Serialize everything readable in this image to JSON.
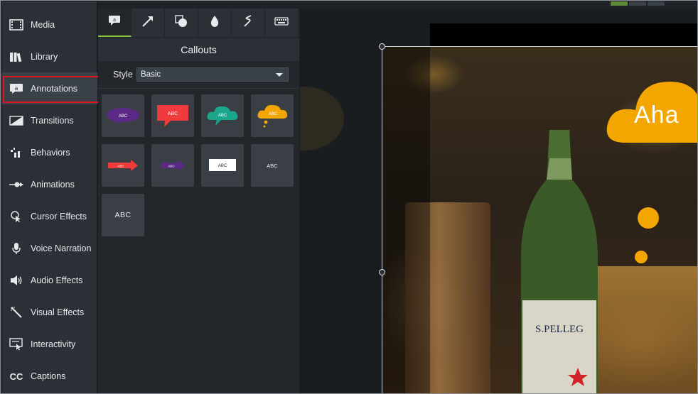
{
  "sidebar": {
    "items": [
      {
        "label": "Media",
        "icon": "film-icon"
      },
      {
        "label": "Library",
        "icon": "library-icon"
      },
      {
        "label": "Annotations",
        "icon": "annotation-icon"
      },
      {
        "label": "Transitions",
        "icon": "transition-icon"
      },
      {
        "label": "Behaviors",
        "icon": "behaviors-icon"
      },
      {
        "label": "Animations",
        "icon": "animation-icon"
      },
      {
        "label": "Cursor Effects",
        "icon": "cursor-icon"
      },
      {
        "label": "Voice Narration",
        "icon": "microphone-icon"
      },
      {
        "label": "Audio Effects",
        "icon": "speaker-icon"
      },
      {
        "label": "Visual Effects",
        "icon": "magic-wand-icon"
      },
      {
        "label": "Interactivity",
        "icon": "interactivity-icon"
      },
      {
        "label": "Captions",
        "icon": "cc-icon"
      }
    ],
    "active_index": 2
  },
  "panel": {
    "tabs": [
      "callout-tab-icon",
      "arrow-icon",
      "shape-icon",
      "blur-drop-icon",
      "sketch-motion-icon",
      "keyboard-icon"
    ],
    "title": "Callouts",
    "style_label": "Style",
    "style_value": "Basic",
    "tiles": [
      {
        "label": "ABC",
        "kind": "speech-bubble",
        "color": "#5b2a86"
      },
      {
        "label": "ABC",
        "kind": "box-callout",
        "color": "#ef3b3b"
      },
      {
        "label": "ABC",
        "kind": "cloud",
        "color": "#1aa88c"
      },
      {
        "label": "ABC",
        "kind": "thought-cloud",
        "color": "#f4a600"
      },
      {
        "label": "ABC",
        "kind": "arrow",
        "color": "#ef3b3b"
      },
      {
        "label": "ABC",
        "kind": "arrow",
        "color": "#5b2a86"
      },
      {
        "label": "ABC",
        "kind": "rectangle",
        "color": "#ffffff"
      },
      {
        "label": "ABC",
        "kind": "text",
        "color": "#e7e9ec"
      },
      {
        "label": "ABC",
        "kind": "text-large",
        "color": "#e7e9ec"
      }
    ]
  },
  "canvas": {
    "callout_text": "Aha",
    "callout_color": "#f4a600",
    "bottle_label": "S.PELLEG"
  },
  "colors": {
    "accent": "#8dc63f",
    "highlight_border": "#e0141e"
  }
}
